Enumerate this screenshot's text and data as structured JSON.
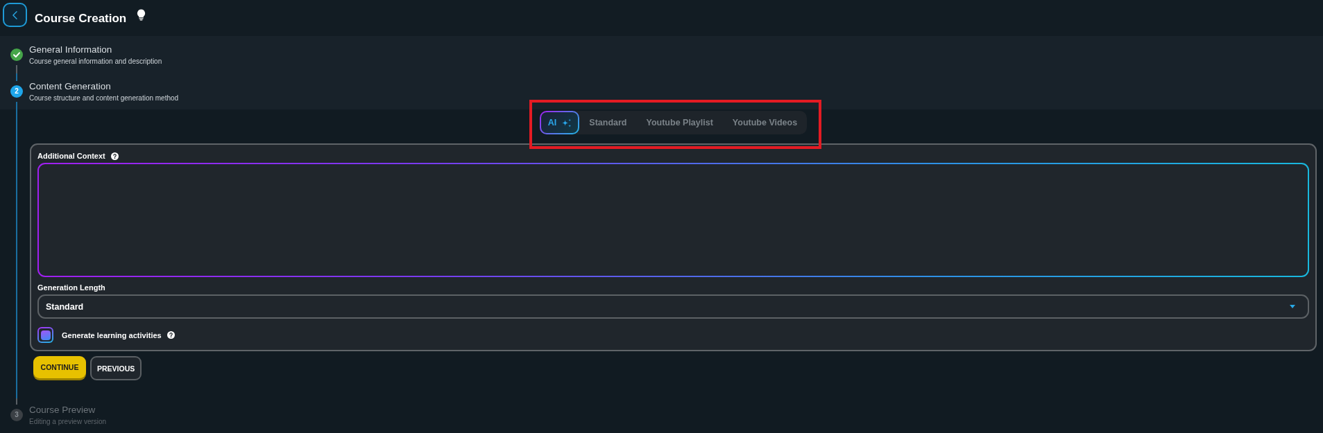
{
  "header": {
    "title": "Course Creation"
  },
  "steps": [
    {
      "kind": "done",
      "title": "General Information",
      "subtitle": "Course general information and description"
    },
    {
      "kind": "active",
      "number": "2",
      "title": "Content Generation",
      "subtitle": "Course structure and content generation method",
      "content": {
        "method_tabs": {
          "highlighted": true,
          "items": [
            {
              "label": "AI",
              "kind": "ai",
              "selected": true
            },
            {
              "label": "Standard",
              "kind": "plain",
              "selected": false
            },
            {
              "label": "Youtube Playlist",
              "kind": "plain",
              "selected": false
            },
            {
              "label": "Youtube Videos",
              "kind": "plain",
              "selected": false
            }
          ]
        },
        "form": {
          "additional_context": {
            "label": "Additional Context"
          },
          "generation_length": {
            "label": "Generation Length",
            "value": "Standard"
          },
          "activities": {
            "label": "Generate learning activities",
            "checked": true
          }
        },
        "buttons": [
          {
            "label": "CONTINUE",
            "kind": "primary"
          },
          {
            "label": "PREVIOUS",
            "kind": "secondary"
          }
        ]
      }
    },
    {
      "kind": "pending",
      "number": "3",
      "title": "Course Preview",
      "subtitle": "Editing a preview version"
    }
  ]
}
